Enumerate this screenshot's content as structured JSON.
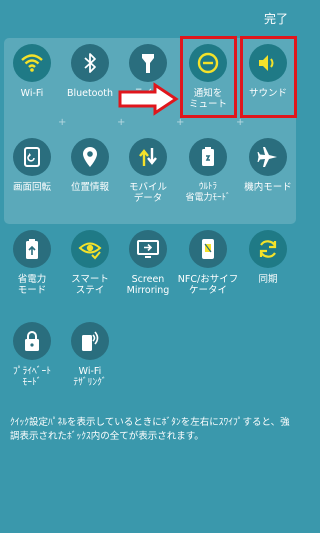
{
  "header": {
    "done_label": "完了"
  },
  "panel_tiles": [
    {
      "label": "Wi-Fi",
      "icon": "wifi-icon",
      "state": "on"
    },
    {
      "label": "Bluetooth",
      "icon": "bluetooth-icon",
      "state": "off"
    },
    {
      "label": "ライト",
      "icon": "flashlight-icon",
      "state": "off"
    },
    {
      "label": "通知を\nミュート",
      "icon": "mute-notification-icon",
      "state": "on"
    },
    {
      "label": "サウンド",
      "icon": "sound-icon",
      "state": "on"
    },
    {
      "label": "画面回転",
      "icon": "screen-rotation-icon",
      "state": "off"
    },
    {
      "label": "位置情報",
      "icon": "location-icon",
      "state": "off"
    },
    {
      "label": "モバイル\nデータ",
      "icon": "mobile-data-icon",
      "state": "off"
    },
    {
      "label": "ｳﾙﾄﾗ\n省電力ﾓｰﾄﾞ",
      "icon": "ultra-power-saving-icon",
      "state": "off"
    },
    {
      "label": "機内モード",
      "icon": "airplane-mode-icon",
      "state": "off"
    }
  ],
  "other_tiles": [
    {
      "label": "省電力\nモード",
      "icon": "power-saving-icon",
      "state": "off"
    },
    {
      "label": "スマート\nステイ",
      "icon": "smart-stay-icon",
      "state": "on"
    },
    {
      "label": "Screen\nMirroring",
      "icon": "screen-mirroring-icon",
      "state": "off"
    },
    {
      "label": "NFC/おサイフ\nケータイ",
      "icon": "nfc-icon",
      "state": "off"
    },
    {
      "label": "同期",
      "icon": "sync-icon",
      "state": "on"
    },
    {
      "label": "ﾌﾟﾗｲﾍﾞｰﾄ\nﾓｰﾄﾞ",
      "icon": "private-mode-icon",
      "state": "off"
    },
    {
      "label": "Wi-Fi\nﾃｻﾞﾘﾝｸﾞ",
      "icon": "wifi-tethering-icon",
      "state": "off"
    }
  ],
  "help_text": "ｸｲｯｸ設定ﾊﾟﾈﾙを表示しているときにﾎﾞﾀﾝを左右にｽﾜｲﾌﾟすると、強調表示されたﾎﾞｯｸｽ内の全てが表示されます。",
  "colors": {
    "background": "#3a98ac",
    "active_icon": "#f4e22a",
    "inactive_icon": "#ffffff",
    "highlight_box": "#e0161c"
  }
}
